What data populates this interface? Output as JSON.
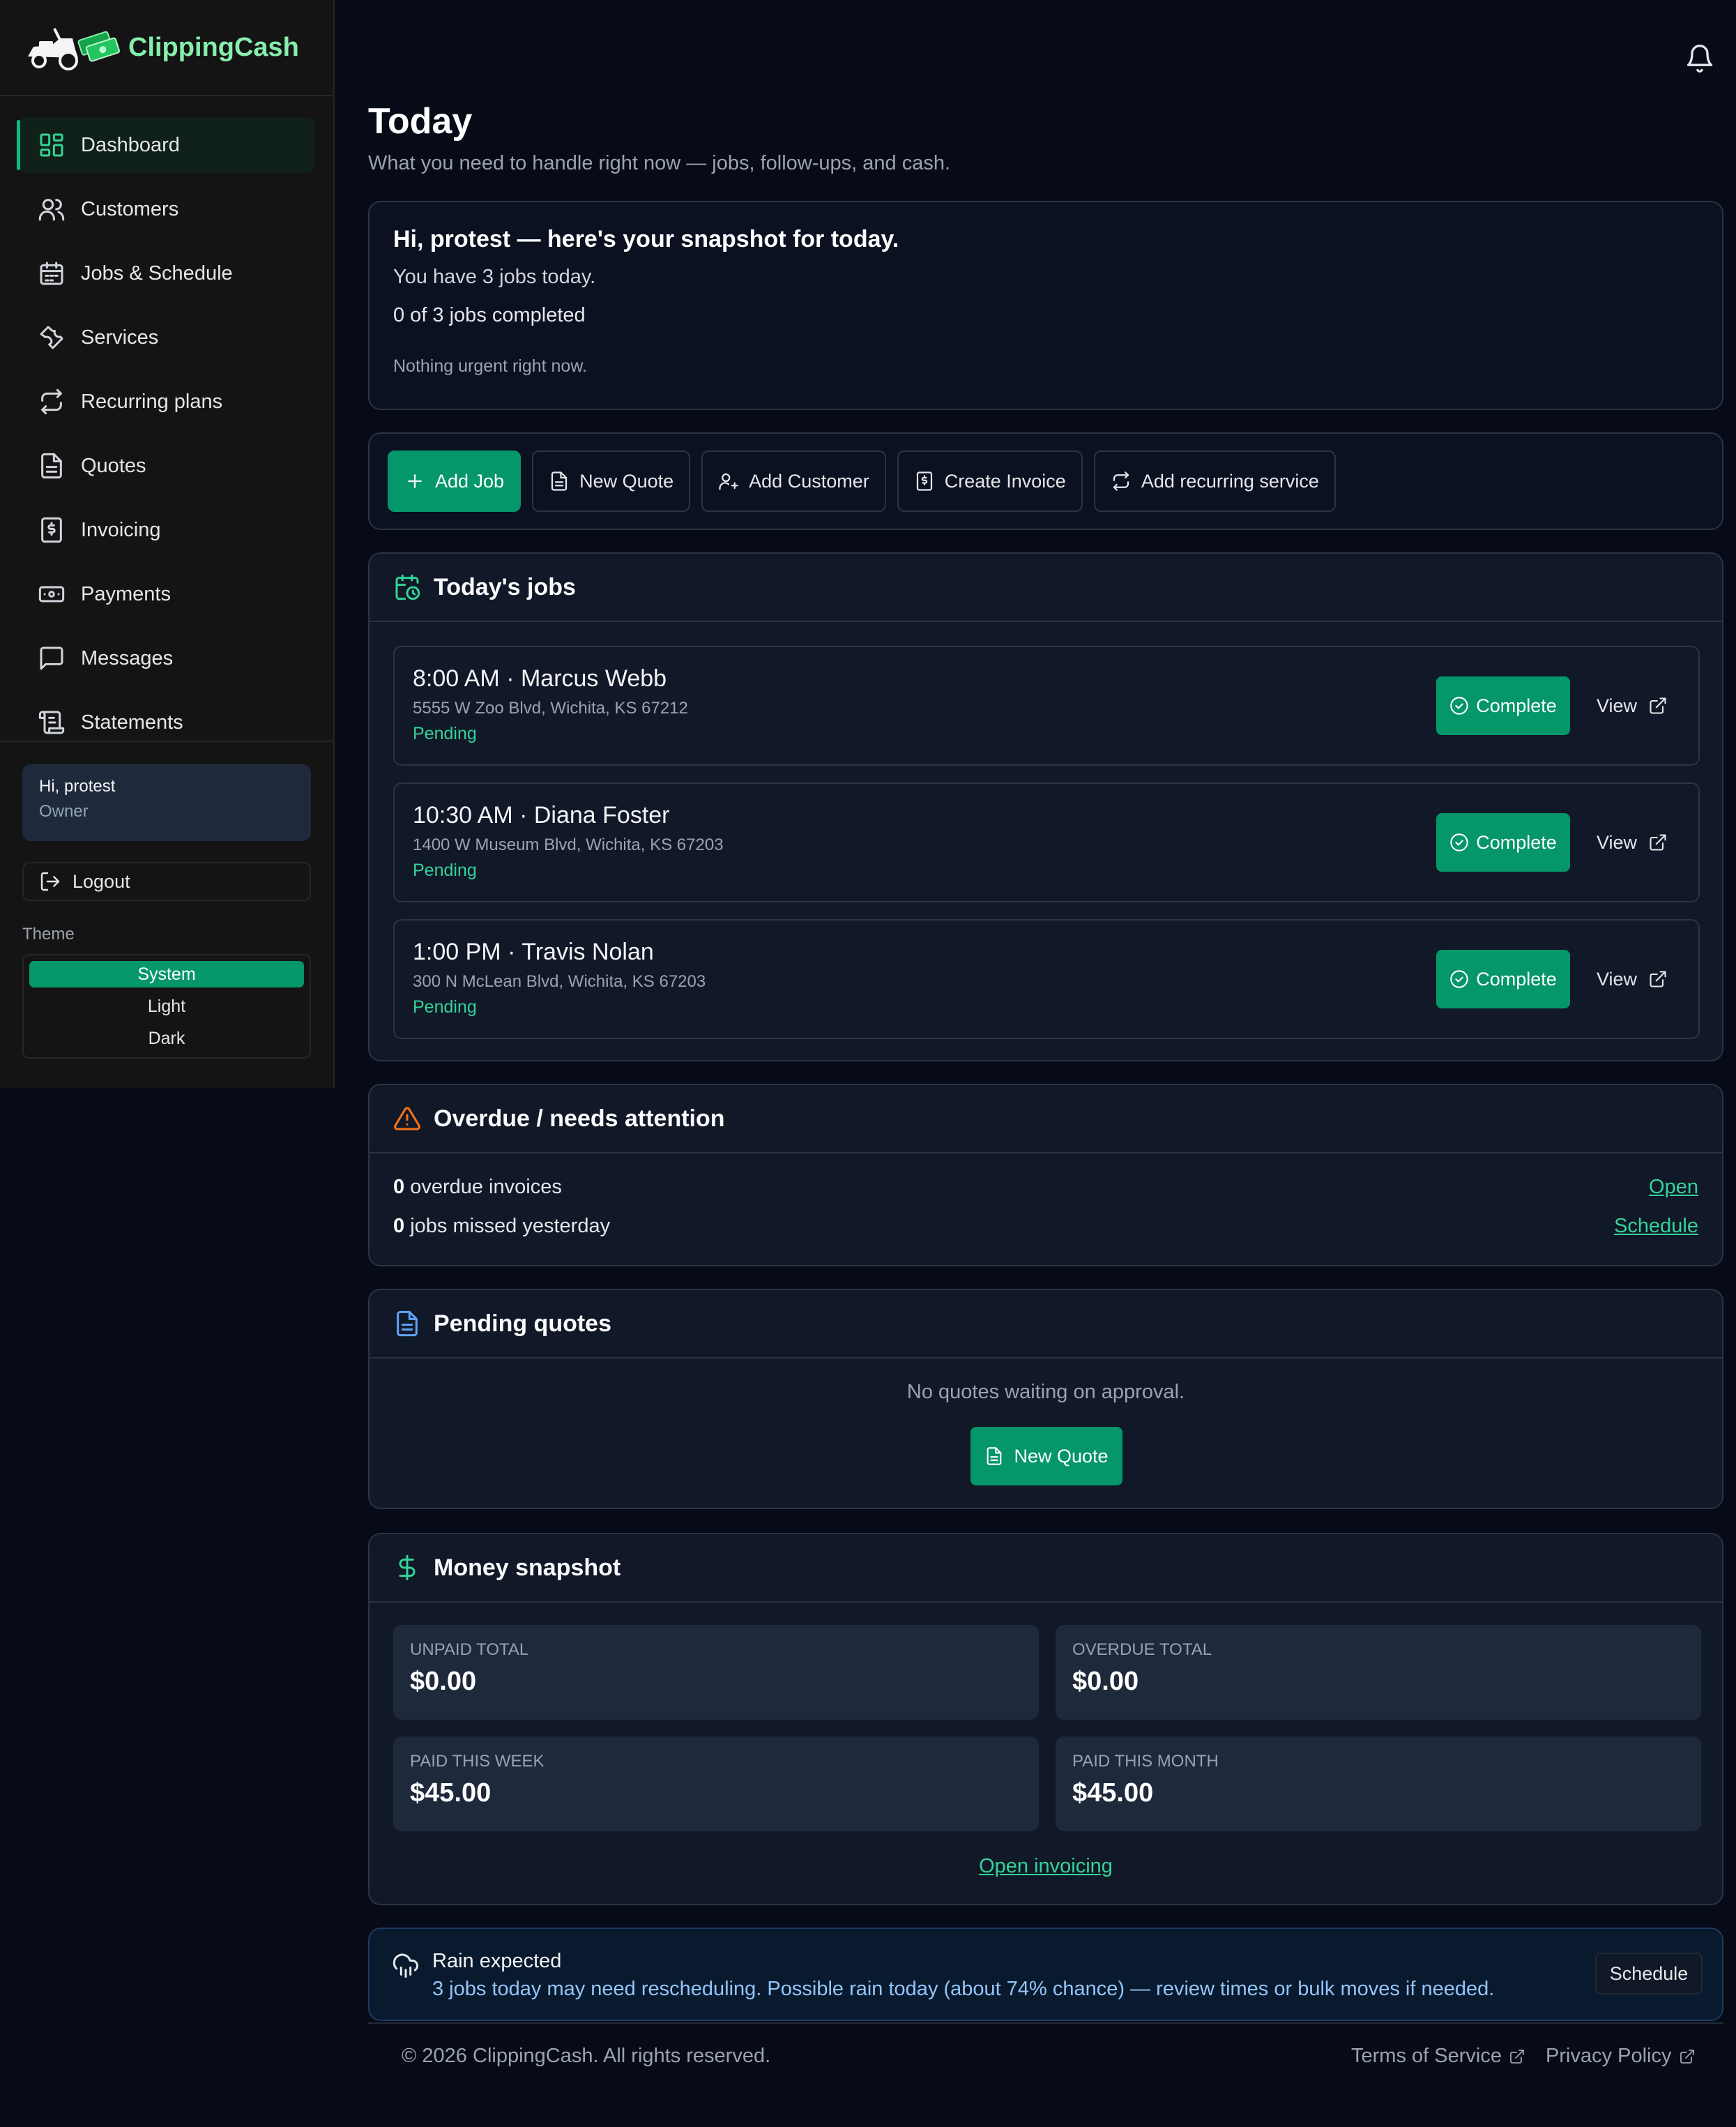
{
  "brand": {
    "name": "ClippingCash",
    "logo_icon": "mower-cash-logo"
  },
  "sidebar": {
    "items": [
      {
        "label": "Dashboard",
        "icon": "dashboard-icon",
        "active": true
      },
      {
        "label": "Customers",
        "icon": "users-icon"
      },
      {
        "label": "Jobs & Schedule",
        "icon": "calendar-icon"
      },
      {
        "label": "Services",
        "icon": "wrench-icon"
      },
      {
        "label": "Recurring plans",
        "icon": "repeat-icon"
      },
      {
        "label": "Quotes",
        "icon": "document-icon"
      },
      {
        "label": "Invoicing",
        "icon": "invoice-icon"
      },
      {
        "label": "Payments",
        "icon": "banknote-icon"
      },
      {
        "label": "Messages",
        "icon": "message-icon"
      },
      {
        "label": "Statements",
        "icon": "scroll-icon"
      }
    ],
    "user": {
      "greeting": "Hi, protest",
      "role": "Owner"
    },
    "logout_label": "Logout",
    "theme": {
      "label": "Theme",
      "options": [
        "System",
        "Light",
        "Dark"
      ],
      "selected": "System"
    }
  },
  "header": {
    "bell_icon": "bell-icon"
  },
  "page": {
    "title": "Today",
    "subtitle": "What you need to handle right now — jobs, follow-ups, and cash."
  },
  "snapshot": {
    "greeting": "Hi, protest — here's your snapshot for today.",
    "jobs_today": "You have 3 jobs today.",
    "completed": "0 of 3 jobs completed",
    "urgent": "Nothing urgent right now."
  },
  "quick_actions": [
    {
      "label": "Add Job",
      "icon": "plus-icon"
    },
    {
      "label": "New Quote",
      "icon": "document-icon"
    },
    {
      "label": "Add Customer",
      "icon": "user-plus-icon"
    },
    {
      "label": "Create Invoice",
      "icon": "invoice-icon"
    },
    {
      "label": "Add recurring service",
      "icon": "repeat-icon"
    }
  ],
  "todays_jobs": {
    "title": "Today's jobs",
    "complete_label": "Complete",
    "view_label": "View",
    "jobs": [
      {
        "title": "8:00 AM · Marcus Webb",
        "address": "5555 W Zoo Blvd, Wichita, KS 67212",
        "status": "Pending"
      },
      {
        "title": "10:30 AM · Diana Foster",
        "address": "1400 W Museum Blvd, Wichita, KS 67203",
        "status": "Pending"
      },
      {
        "title": "1:00 PM · Travis Nolan",
        "address": "300 N McLean Blvd, Wichita, KS 67203",
        "status": "Pending"
      }
    ]
  },
  "overdue": {
    "title": "Overdue / needs attention",
    "rows": [
      {
        "count": "0",
        "text": " overdue invoices",
        "link": "Open"
      },
      {
        "count": "0",
        "text": " jobs missed yesterday",
        "link": "Schedule"
      }
    ]
  },
  "pending_quotes": {
    "title": "Pending quotes",
    "empty": "No quotes waiting on approval.",
    "button": "New Quote"
  },
  "money": {
    "title": "Money snapshot",
    "tiles": [
      {
        "label": "UNPAID TOTAL",
        "value": "$0.00"
      },
      {
        "label": "OVERDUE TOTAL",
        "value": "$0.00"
      },
      {
        "label": "PAID THIS WEEK",
        "value": "$45.00"
      },
      {
        "label": "PAID THIS MONTH",
        "value": "$45.00"
      }
    ],
    "link": "Open invoicing"
  },
  "rain": {
    "title": "Rain expected",
    "message": "3 jobs today may need rescheduling. Possible rain today (about 74% chance) — review times or bulk moves if needed.",
    "button": "Schedule"
  },
  "footer": {
    "copyright": "© 2026 ClippingCash. All rights reserved.",
    "terms": "Terms of Service",
    "privacy": "Privacy Policy"
  },
  "colors": {
    "accent": "#059669",
    "accent_text": "#34d399",
    "background": "#060b17",
    "sidebar": "#141414",
    "warning": "#f97316",
    "info": "#60a5fa"
  }
}
